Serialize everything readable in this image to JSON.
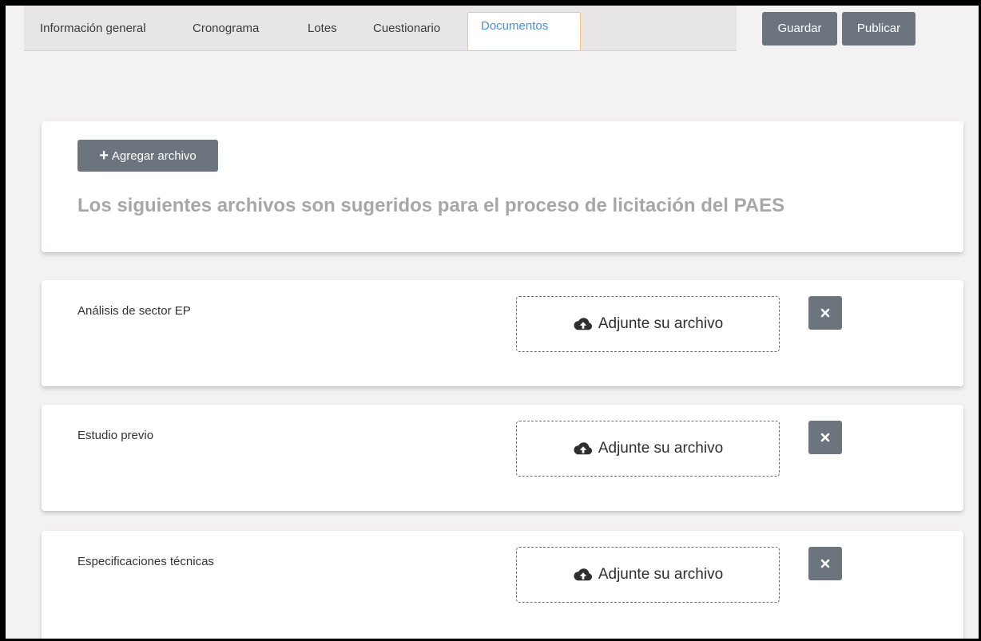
{
  "tabs": [
    {
      "label": "Información general"
    },
    {
      "label": "Cronograma"
    },
    {
      "label": "Lotes"
    },
    {
      "label": "Cuestionario"
    },
    {
      "label": "Documentos",
      "active": true
    }
  ],
  "toolbar": {
    "save_label": "Guardar",
    "publish_label": "Publicar"
  },
  "suggestions": {
    "add_button_label": "Agregar archivo",
    "heading": "Los siguientes archivos son sugeridos para el proceso de licitación del PAES"
  },
  "documents": [
    {
      "name": "Análisis de sector EP",
      "upload_label": "Adjunte su archivo"
    },
    {
      "name": "Estudio previo",
      "upload_label": "Adjunte su archivo"
    },
    {
      "name": "Especificaciones técnicas",
      "upload_label": "Adjunte su archivo"
    }
  ],
  "icons": {
    "add": "plus-icon",
    "upload": "cloud-upload-icon",
    "remove": "close-icon"
  },
  "colors": {
    "button_bg": "#6c757d",
    "active_tab_text": "#4a8fd8",
    "active_tab_border": "#f0c77a",
    "page_bg": "#f3f1f2"
  }
}
